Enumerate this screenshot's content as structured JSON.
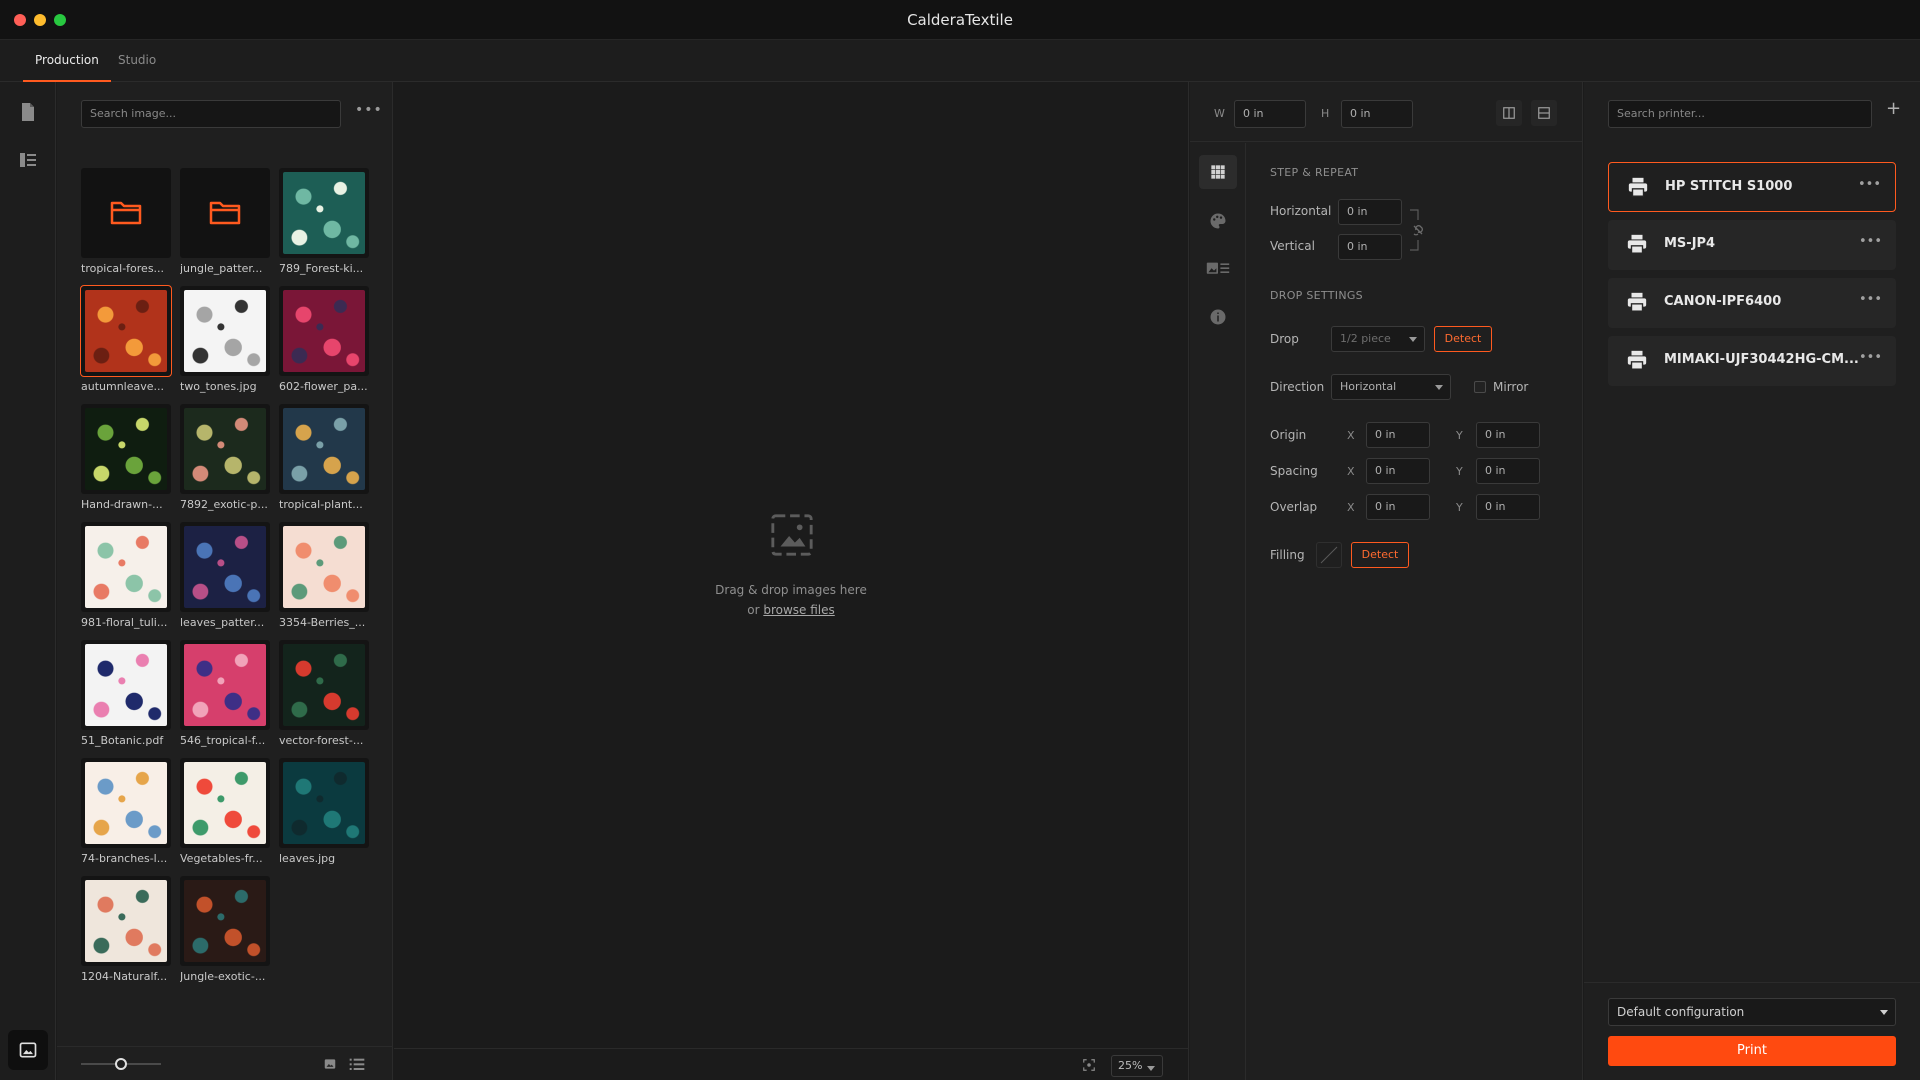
{
  "window": {
    "title": "CalderaTextile"
  },
  "tabs": [
    {
      "label": "Production",
      "active": true
    },
    {
      "label": "Studio",
      "active": false
    }
  ],
  "library": {
    "search_placeholder": "Search image...",
    "items": [
      {
        "label": "tropical-fores...",
        "kind": "folder"
      },
      {
        "label": "jungle_patter...",
        "kind": "folder"
      },
      {
        "label": "789_Forest-ki...",
        "kind": "image",
        "colors": [
          "#1d5e55",
          "#6fb8a3",
          "#e9f2e4"
        ]
      },
      {
        "label": "autumnleave...",
        "kind": "image",
        "selected": true,
        "colors": [
          "#b1331b",
          "#f39a3a",
          "#6b1f12"
        ]
      },
      {
        "label": "two_tones.jpg",
        "kind": "image",
        "colors": [
          "#f4f4f4",
          "#a5a5a5",
          "#333333"
        ]
      },
      {
        "label": "602-flower_pa...",
        "kind": "image",
        "colors": [
          "#7a1637",
          "#e7456c",
          "#3b2a52"
        ]
      },
      {
        "label": "Hand-drawn-...",
        "kind": "image",
        "colors": [
          "#0f1d10",
          "#6aa33b",
          "#c7d76a"
        ]
      },
      {
        "label": "7892_exotic-p...",
        "kind": "image",
        "colors": [
          "#1c2a1d",
          "#b6b56b",
          "#d38a78"
        ]
      },
      {
        "label": "tropical-plant...",
        "kind": "image",
        "colors": [
          "#22384a",
          "#d6a34c",
          "#7aa0a8"
        ]
      },
      {
        "label": "981-floral_tuli...",
        "kind": "image",
        "colors": [
          "#f6f0ea",
          "#8cc4a8",
          "#e87a64"
        ]
      },
      {
        "label": "leaves_patter...",
        "kind": "image",
        "colors": [
          "#1c2144",
          "#4a74b6",
          "#b84f87"
        ]
      },
      {
        "label": "3354-Berries_...",
        "kind": "image",
        "colors": [
          "#f5ddd2",
          "#f08d6e",
          "#5c9a7a"
        ]
      },
      {
        "label": "51_Botanic.pdf",
        "kind": "image",
        "colors": [
          "#f3f3f3",
          "#1f2a6b",
          "#ea7fb0"
        ]
      },
      {
        "label": "546_tropical-f...",
        "kind": "image",
        "colors": [
          "#d63f6c",
          "#3e2f86",
          "#f1a3b9"
        ]
      },
      {
        "label": "vector-forest-...",
        "kind": "image",
        "colors": [
          "#13241c",
          "#d63a2e",
          "#2f6b4a"
        ]
      },
      {
        "label": "74-branches-l...",
        "kind": "image",
        "colors": [
          "#f8efe7",
          "#6b9bc8",
          "#e6a54a"
        ]
      },
      {
        "label": "Vegetables-fr...",
        "kind": "image",
        "colors": [
          "#f4efe6",
          "#ef4a3b",
          "#3d9a6a"
        ]
      },
      {
        "label": "leaves.jpg",
        "kind": "image",
        "colors": [
          "#0b3a3f",
          "#1f7876",
          "#0f2a2e"
        ]
      },
      {
        "label": "1204-Naturalf...",
        "kind": "image",
        "colors": [
          "#efe6dc",
          "#e07a5f",
          "#3a6b5a"
        ]
      },
      {
        "label": "Jungle-exotic-...",
        "kind": "image",
        "colors": [
          "#2a1a16",
          "#c2512a",
          "#2c6b6a"
        ]
      }
    ]
  },
  "canvas": {
    "drop_line1": "Drag & drop images here",
    "drop_line2_prefix": "or ",
    "drop_link": "browse files",
    "zoom": "25%"
  },
  "settings": {
    "w_label": "W",
    "w_value": "0 in",
    "h_label": "H",
    "h_value": "0 in",
    "step_repeat_title": "STEP & REPEAT",
    "horizontal_label": "Horizontal",
    "horizontal_value": "0 in",
    "vertical_label": "Vertical",
    "vertical_value": "0 in",
    "drop_settings_title": "DROP SETTINGS",
    "drop_label": "Drop",
    "drop_value": "1/2 piece",
    "detect_label": "Detect",
    "direction_label": "Direction",
    "direction_value": "Horizontal",
    "mirror_label": "Mirror",
    "origin_label": "Origin",
    "spacing_label": "Spacing",
    "overlap_label": "Overlap",
    "x_label": "X",
    "y_label": "Y",
    "origin_x": "0 in",
    "origin_y": "0 in",
    "spacing_x": "0 in",
    "spacing_y": "0 in",
    "overlap_x": "0 in",
    "overlap_y": "0 in",
    "filling_label": "Filling"
  },
  "printers": {
    "search_placeholder": "Search printer...",
    "add_symbol": "+",
    "items": [
      {
        "name": "HP STITCH S1000",
        "selected": true
      },
      {
        "name": "MS-JP4",
        "selected": false
      },
      {
        "name": "CANON-IPF6400",
        "selected": false
      },
      {
        "name": "MIMAKI-UJF30442HG-CM...",
        "selected": false
      }
    ],
    "config_value": "Default configuration",
    "print_label": "Print"
  },
  "colors": {
    "accent": "#ff5a1f",
    "print_button": "#ff4a10"
  }
}
